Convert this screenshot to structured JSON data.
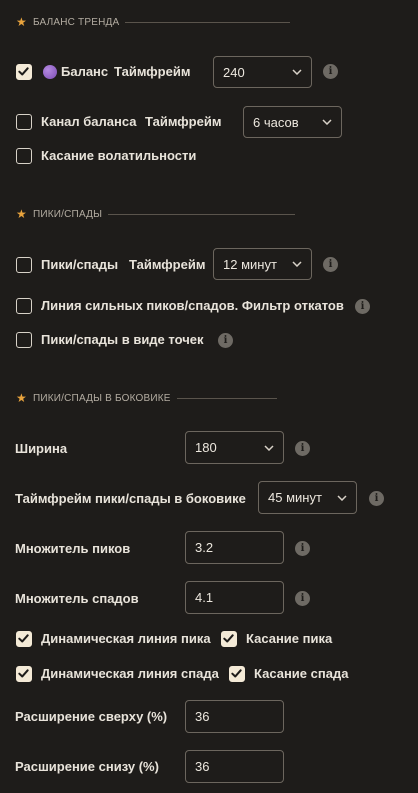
{
  "sections": {
    "trend_balance": "БАЛАНС ТРЕНДА",
    "peaks_troughs": "ПИКИ/СПАДЫ",
    "peaks_sideways": "ПИКИ/СПАДЫ В БОКОВИКЕ"
  },
  "balance": {
    "checked": true,
    "label": "Баланс",
    "tf_label": "Таймфрейм",
    "tf_value": "240"
  },
  "balance_channel": {
    "checked": false,
    "label": "Канал баланса",
    "tf_label": "Таймфрейм",
    "tf_value": "6 часов"
  },
  "volatility_touch": {
    "checked": false,
    "label": "Касание волатильности"
  },
  "peaks": {
    "checked": false,
    "label": "Пики/спады",
    "tf_label": "Таймфрейм",
    "tf_value": "12 минут"
  },
  "strong_line": {
    "checked": false,
    "label": "Линия сильных пиков/спадов. Фильтр откатов"
  },
  "dots": {
    "checked": false,
    "label": "Пики/спады в виде точек"
  },
  "width": {
    "label": "Ширина",
    "value": "180"
  },
  "sideways_tf": {
    "label": "Таймфрейм пики/спады в боковике",
    "value": "45 минут"
  },
  "peak_mult": {
    "label": "Множитель пиков",
    "value": "3.2"
  },
  "trough_mult": {
    "label": "Множитель спадов",
    "value": "4.1"
  },
  "dyn_peak": {
    "checked": true,
    "label": "Динамическая линия пика"
  },
  "peak_touch": {
    "checked": true,
    "label": "Касание пика"
  },
  "dyn_trough": {
    "checked": true,
    "label": "Динамическая линия спада"
  },
  "trough_touch": {
    "checked": true,
    "label": "Касание спада"
  },
  "ext_top": {
    "label": "Расширение сверху (%)",
    "value": "36"
  },
  "ext_bottom": {
    "label": "Расширение снизу (%)",
    "value": "36"
  },
  "icons": {
    "info": "info-icon",
    "star": "star-icon",
    "check": "check-icon",
    "chevron": "chevron-down-icon",
    "dot": "purple-dot-icon"
  },
  "colors": {
    "background": "#1e1c1a",
    "star": "#e8a33d",
    "checkbox_on": "#f4ead7",
    "dot": "#9b6bd0"
  }
}
